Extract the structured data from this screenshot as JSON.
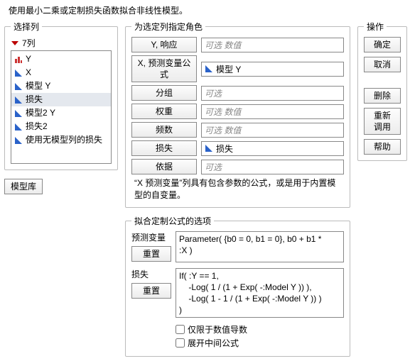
{
  "description": "使用最小二乘或定制损失函数拟合非线性模型。",
  "select_cols": {
    "legend": "选择列",
    "header": "7列",
    "items": [
      {
        "label": "Y",
        "icon": "bar"
      },
      {
        "label": "X",
        "icon": "tri"
      },
      {
        "label": "模型 Y",
        "icon": "tri"
      },
      {
        "label": "损失",
        "icon": "tri",
        "selected": true
      },
      {
        "label": "模型2 Y",
        "icon": "tri"
      },
      {
        "label": "损失2",
        "icon": "tri"
      },
      {
        "label": "使用无模型列的损失",
        "icon": "tri"
      }
    ],
    "model_library": "模型库"
  },
  "roles": {
    "legend": "为选定列指定角色",
    "rows": [
      {
        "label": "Y, 响应",
        "placeholder": "可选  数值",
        "value": ""
      },
      {
        "label": "X, 预测变量公式",
        "placeholder": "",
        "value": "模型 Y",
        "icon": "tri"
      },
      {
        "label": "分组",
        "placeholder": "可选",
        "value": ""
      },
      {
        "label": "权重",
        "placeholder": "可选  数值",
        "value": ""
      },
      {
        "label": "频数",
        "placeholder": "可选  数值",
        "value": ""
      },
      {
        "label": "损失",
        "placeholder": "",
        "value": "损失",
        "icon": "tri"
      },
      {
        "label": "依据",
        "placeholder": "可选",
        "value": ""
      }
    ],
    "hint": "“X 预测变量”列具有包含参数的公式，或是用于内置模型的自变量。"
  },
  "actions": {
    "legend": "操作",
    "ok": "确定",
    "cancel": "取消",
    "remove": "删除",
    "recall": "重新调用",
    "help": "帮助"
  },
  "options": {
    "legend": "拟合定制公式的选项",
    "predictor_label": "预测变量",
    "predictor_reset": "重置",
    "predictor_text": "Parameter( {b0 = 0, b1 = 0}, b0 + b1 *\n:X )",
    "loss_label": "损失",
    "loss_reset": "重置",
    "loss_text": "If( :Y == 1,\n    -Log( 1 / (1 + Exp( -:Model Y )) ),\n    -Log( 1 - 1 / (1 + Exp( -:Model Y )) )\n)",
    "chk_numeric_deriv": "仅限于数值导数",
    "chk_expand": "展开中间公式"
  }
}
